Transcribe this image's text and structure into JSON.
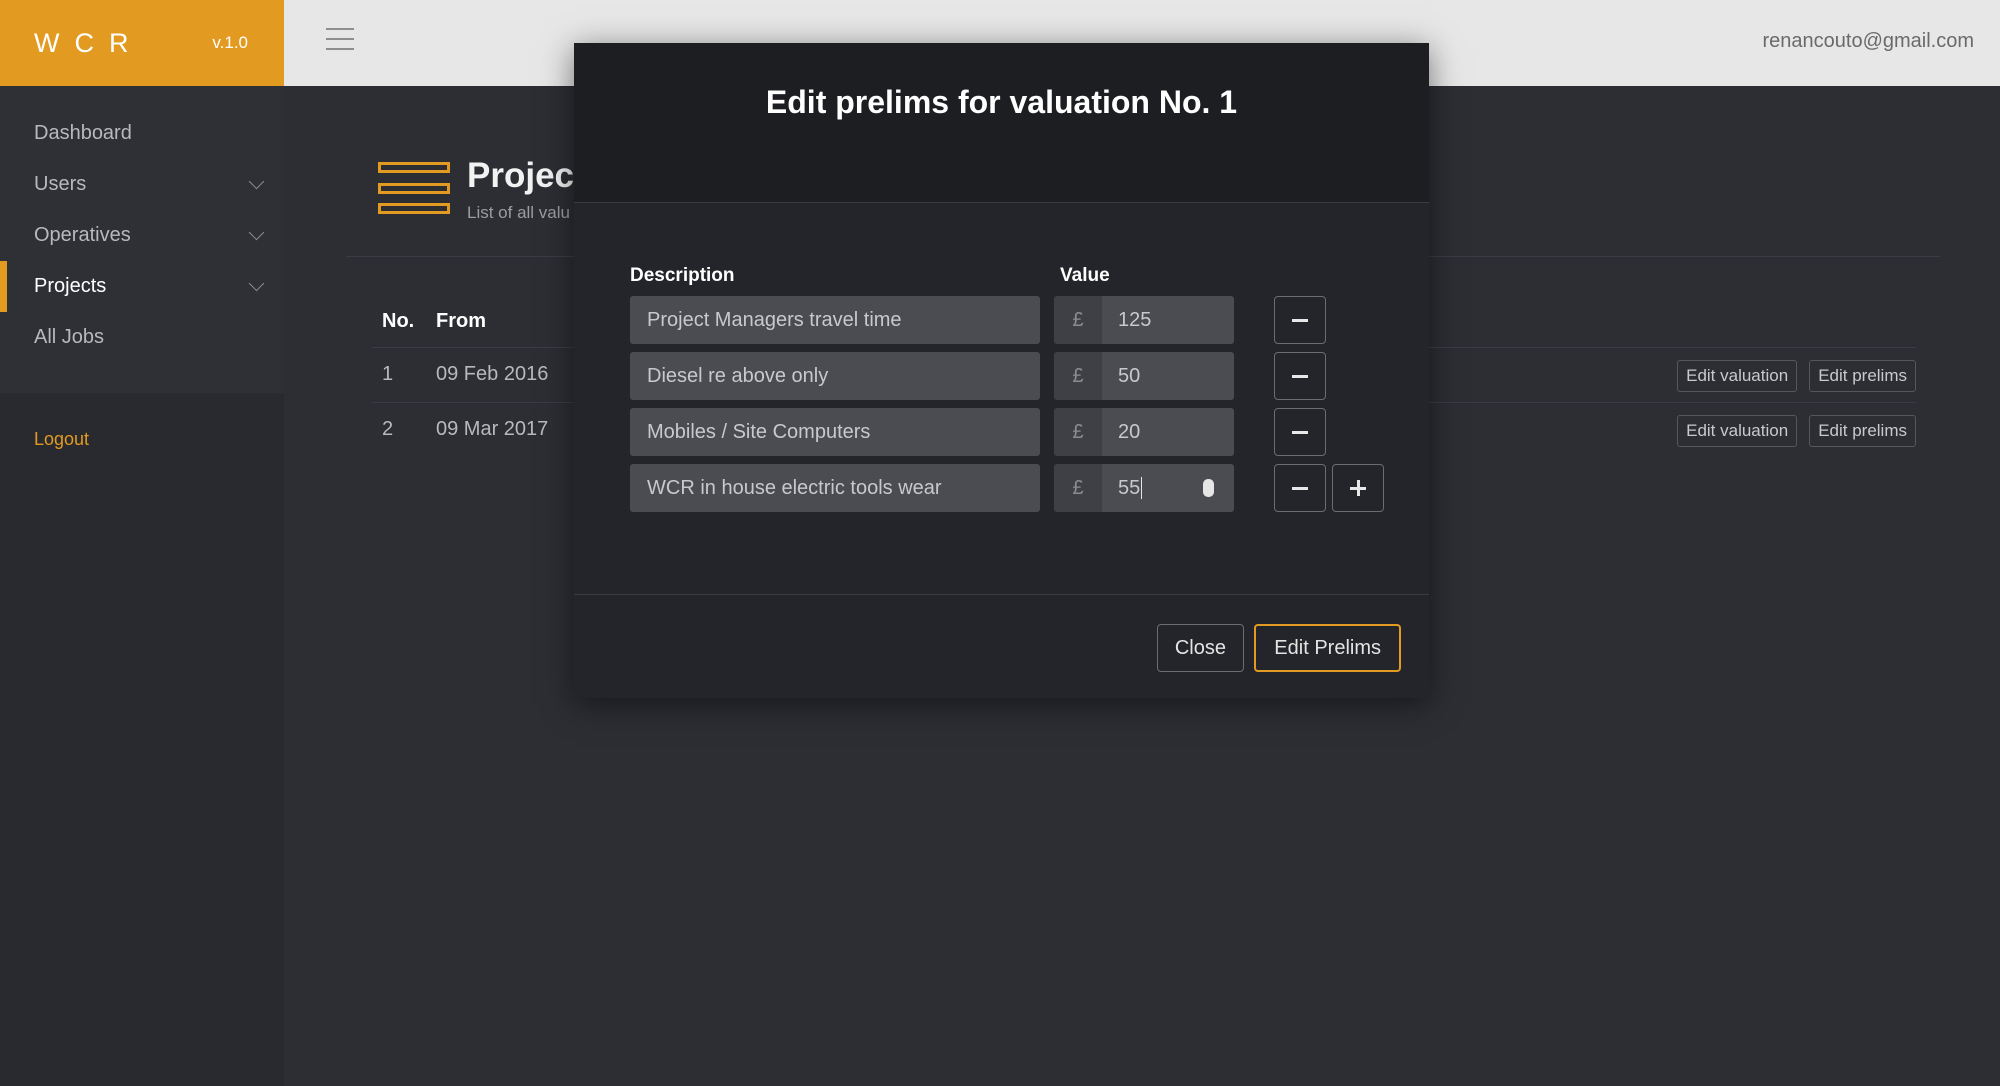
{
  "brand": {
    "name": "WCR",
    "version": "v.1.0"
  },
  "topbar": {
    "user_email": "renancouto@gmail.com"
  },
  "sidebar": {
    "items": [
      {
        "label": "Dashboard"
      },
      {
        "label": "Users"
      },
      {
        "label": "Operatives"
      },
      {
        "label": "Projects"
      },
      {
        "label": "All Jobs"
      }
    ],
    "active_item": "Projects",
    "logout": "Logout"
  },
  "page": {
    "title": "Project",
    "subtitle": "List of all valu"
  },
  "table": {
    "headers": {
      "no": "No.",
      "from": "From"
    },
    "rows": [
      {
        "no": "1",
        "from": "09 Feb 2016",
        "edit_valuation": "Edit valuation",
        "edit_prelims": "Edit prelims"
      },
      {
        "no": "2",
        "from": "09 Mar 2017",
        "edit_valuation": "Edit valuation",
        "edit_prelims": "Edit prelims"
      }
    ]
  },
  "modal": {
    "title": "Edit prelims for valuation No. 1",
    "description_label": "Description",
    "value_label": "Value",
    "currency_symbol": "£",
    "prelims": [
      {
        "description": "Project Managers travel time",
        "value": "125"
      },
      {
        "description": "Diesel re above only",
        "value": "50"
      },
      {
        "description": "Mobiles / Site Computers",
        "value": "20"
      },
      {
        "description": "WCR in house electric tools wear",
        "value": "55"
      }
    ],
    "close_label": "Close",
    "submit_label": "Edit Prelims"
  },
  "colors": {
    "accent": "#e39a20",
    "sidebar_bg": "#282a30",
    "main_bg": "#2c2e34",
    "modal_bg": "#23252a",
    "topbar_bg": "#e7e7e7"
  }
}
